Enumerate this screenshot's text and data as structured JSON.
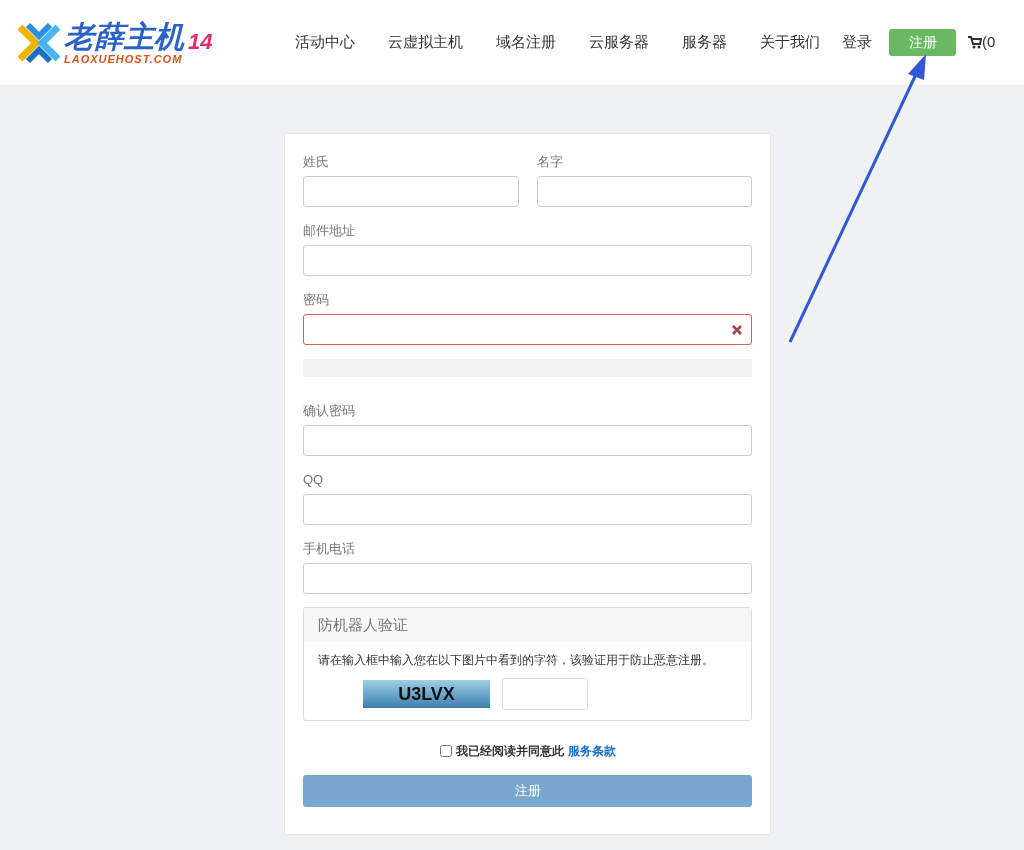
{
  "header": {
    "logo": {
      "name": "老薛主机",
      "domain": "LAOXUEHOST.COM",
      "badge": "14"
    },
    "nav": [
      {
        "label": "活动中心"
      },
      {
        "label": "云虚拟主机"
      },
      {
        "label": "域名注册"
      },
      {
        "label": "云服务器"
      },
      {
        "label": "服务器"
      },
      {
        "label": "关于我们"
      }
    ],
    "login": "登录",
    "register": "注册",
    "cart": "(0"
  },
  "form": {
    "name_fields": [
      {
        "label": "姓氏",
        "error": false
      },
      {
        "label": "名字",
        "error": false
      }
    ],
    "fields_top": [
      {
        "label": "邮件地址",
        "error": false
      },
      {
        "label": "密码",
        "error": true
      }
    ],
    "password_strength": {
      "level": 0
    },
    "fields_bottom": [
      {
        "label": "确认密码",
        "error": false
      },
      {
        "label": "QQ",
        "error": false
      },
      {
        "label": "手机电话",
        "error": false
      }
    ],
    "captcha": {
      "title": "防机器人验证",
      "instruction": "请在输入框中输入您在以下图片中看到的字符，该验证用于防止恶意注册。",
      "code": "U3LVX"
    },
    "agree": {
      "checked": false,
      "text": "我已经阅读并同意此",
      "link": "服务条款"
    },
    "submit": {
      "label": "注册",
      "disabled": true
    }
  }
}
